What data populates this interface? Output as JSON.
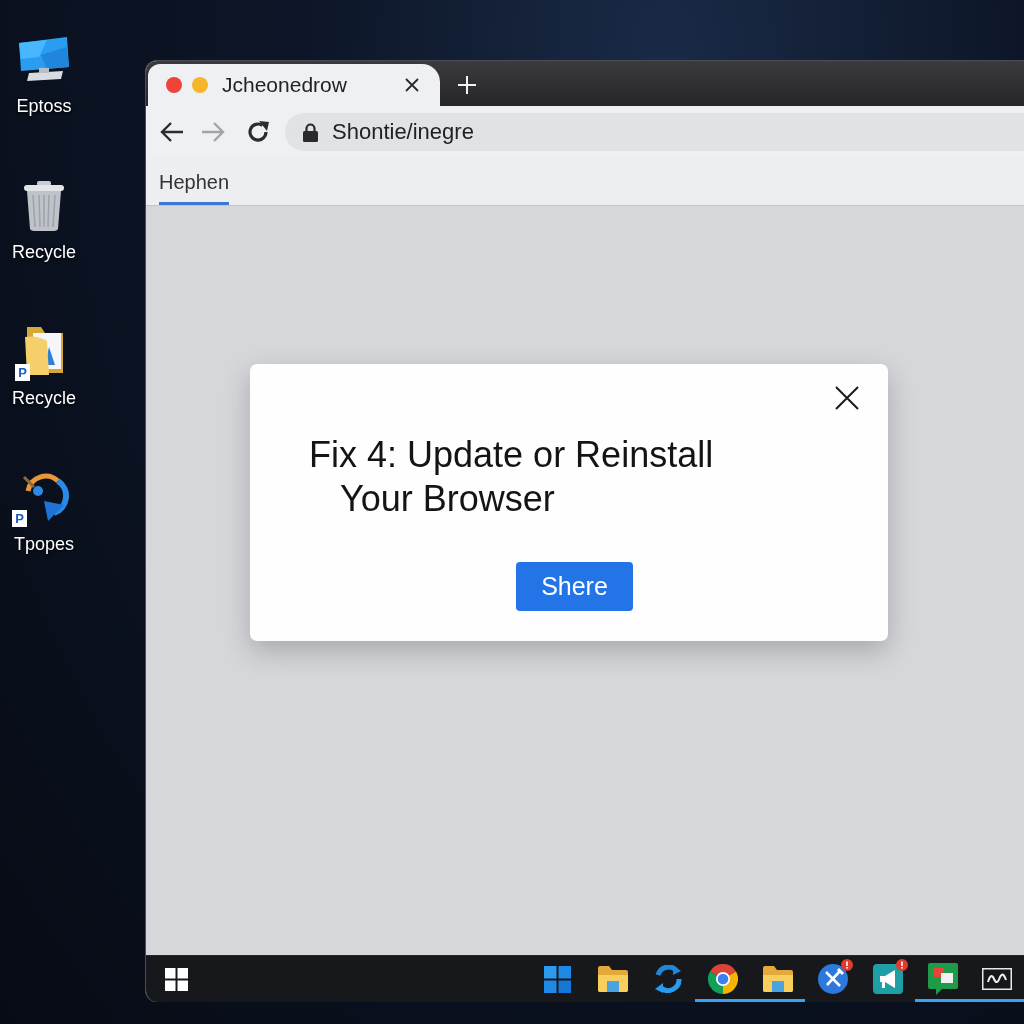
{
  "desktop_icons": [
    {
      "kind": "monitor",
      "label": "Eptoss"
    },
    {
      "kind": "bin",
      "label": "Recycle"
    },
    {
      "kind": "folder",
      "label": "Recycle",
      "overlay": "P"
    },
    {
      "kind": "sync",
      "label": "Tpopes",
      "overlay": "P"
    }
  ],
  "browser": {
    "tabs": [
      {
        "title": "Jcheonedrow",
        "selected": true
      }
    ],
    "nav_buttons": [
      {
        "kind": "back",
        "disabled": false
      },
      {
        "kind": "forward",
        "disabled": true
      },
      {
        "kind": "reload",
        "disabled": false
      }
    ],
    "address": "Shontie/inegre",
    "page_tabs": [
      {
        "label": "Hephen",
        "selected": true
      }
    ]
  },
  "dialog": {
    "title": "Fix 4: Update or Reinstall\nYour Browser",
    "button": "Shere"
  },
  "taskbar": {
    "items": [
      {
        "kind": "panes",
        "running": false,
        "badge": false
      },
      {
        "kind": "folder",
        "running": false,
        "badge": false
      },
      {
        "kind": "sync",
        "running": false,
        "badge": false
      },
      {
        "kind": "wheel",
        "running": true,
        "badge": false
      },
      {
        "kind": "folder",
        "running": true,
        "badge": false
      },
      {
        "kind": "tools",
        "running": false,
        "badge": true
      },
      {
        "kind": "megaphone",
        "running": false,
        "badge": true
      },
      {
        "kind": "chat",
        "running": true,
        "badge": false
      },
      {
        "kind": "tray",
        "running": true,
        "badge": false
      }
    ]
  }
}
